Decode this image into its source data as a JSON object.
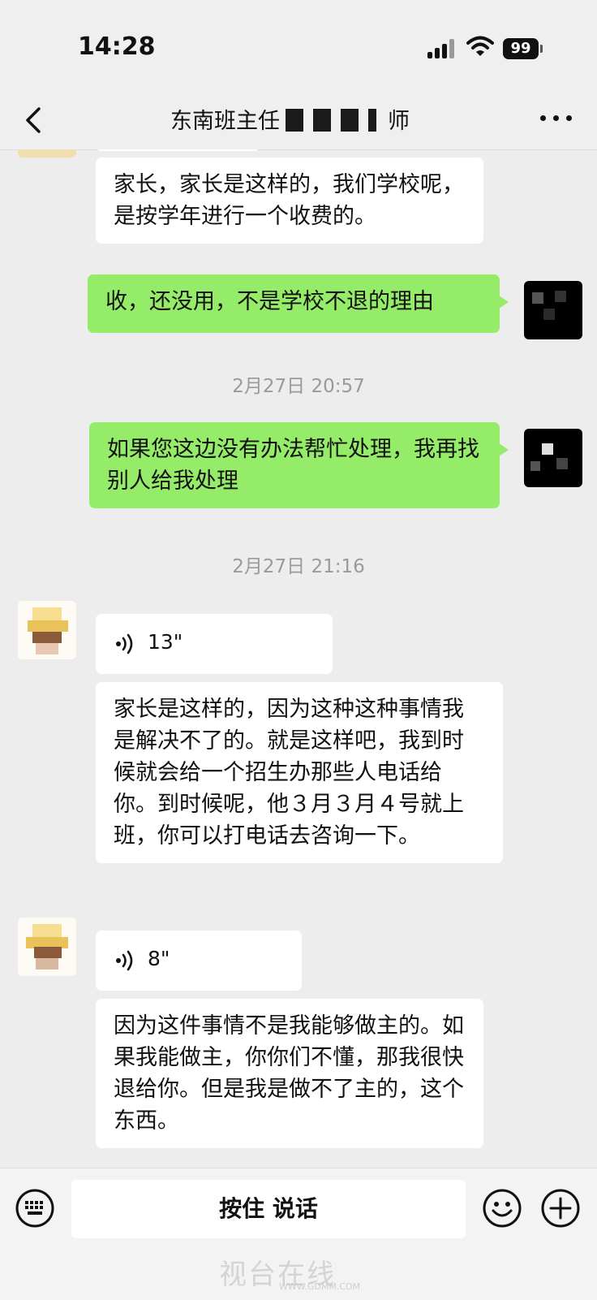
{
  "status_bar": {
    "time": "14:28",
    "battery": "99"
  },
  "nav": {
    "title_start": "东南班主任",
    "title_end": "师"
  },
  "messages": [
    {
      "type": "text",
      "sender": "them",
      "text": "家长，家长是这样的，我们学校呢，是按学年进行一个收费的。"
    },
    {
      "type": "text",
      "sender": "me",
      "text": "收，还没用，不是学校不退的理由"
    },
    {
      "type": "time",
      "text": "2月27日 20:57"
    },
    {
      "type": "text",
      "sender": "me",
      "text": "如果您这边没有办法帮忙处理，我再找别人给我处理"
    },
    {
      "type": "time",
      "text": "2月27日 21:16"
    },
    {
      "type": "voice",
      "sender": "them",
      "duration": "13\""
    },
    {
      "type": "text",
      "sender": "them",
      "text": "家长是这样的，因为这种这种事情我是解决不了的。就是这样吧，我到时候就会给一个招生办那些人电话给你。到时候呢，他３月３月４号就上班，你可以打电话去咨询一下。"
    },
    {
      "type": "voice",
      "sender": "them",
      "duration": "8\""
    },
    {
      "type": "text",
      "sender": "them",
      "text": "因为这件事情不是我能够做主的。如果我能做主，你你们不懂，那我很快退给你。但是我是做不了主的，这个东西。"
    }
  ],
  "input_bar": {
    "talk_label": "按住 说话"
  },
  "watermark": {
    "text": "视台在线",
    "sub": "WWW.GDMM.COM"
  },
  "icons": {
    "back": "chevron-left-icon",
    "more": "more-dots-icon",
    "voice": "voice-wave-icon",
    "keyboard": "keyboard-icon",
    "emoji": "emoji-icon",
    "plus": "plus-icon"
  },
  "colors": {
    "my_bubble": "#95ec69",
    "their_bubble": "#ffffff",
    "background": "#ededed"
  }
}
